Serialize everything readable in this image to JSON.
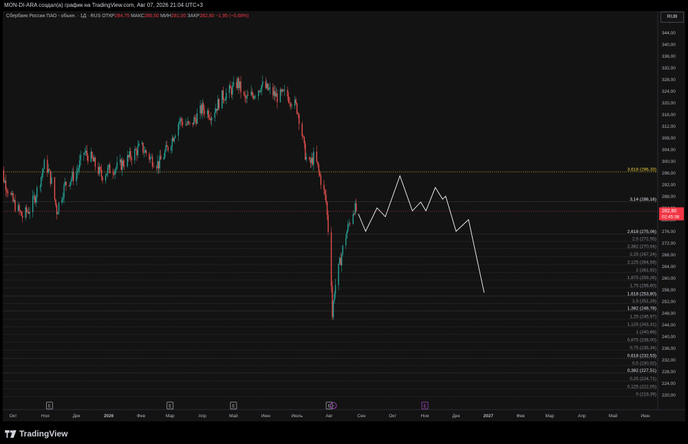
{
  "header": {
    "title": "MON-DI-ARA создал(а) график на TradingView.com, Авг 07, 2026 21:04 UTC+3"
  },
  "legend": {
    "symbol": "Сбербанк России ПАО - обыкн. · 1Д · RUS",
    "open_label": "ОТКР",
    "open": "284,75",
    "high_label": "МАКС",
    "high": "285,50",
    "low_label": "МИН",
    "low": "281,00",
    "close_label": "ЗАКР",
    "close": "282,80",
    "change": "−1,95 (−0,68%)"
  },
  "currency": "RUB",
  "brand": {
    "name": "TradingView"
  },
  "colors": {
    "background": "#131313",
    "up": "#26a69a",
    "down": "#ef5350",
    "price_tag": "#f23645",
    "fib_top": "#f5d142",
    "fib_line": "#5d606b",
    "projection": "#ffffff"
  },
  "chart_data": {
    "type": "candlestick",
    "ylim": [
      218,
      350
    ],
    "y_ticks": [
      "220,00",
      "224,00",
      "228,00",
      "232,00",
      "236,00",
      "240,00",
      "244,00",
      "248,00",
      "252,00",
      "256,00",
      "260,00",
      "264,00",
      "268,00",
      "272,00",
      "276,00",
      "280,00",
      "284,00",
      "288,00",
      "292,00",
      "296,00",
      "300,00",
      "304,00",
      "308,00",
      "312,00",
      "316,00",
      "320,00",
      "324,00",
      "328,00",
      "332,00",
      "336,00",
      "340,00",
      "344,00",
      "348,00"
    ],
    "x_ticks": [
      {
        "label": "Окт",
        "date": "2025-10-01"
      },
      {
        "label": "Ноя",
        "date": "2025-11-01"
      },
      {
        "label": "Дек",
        "date": "2025-12-01"
      },
      {
        "label": "2026",
        "date": "2026-01-01"
      },
      {
        "label": "Фев",
        "date": "2026-02-01"
      },
      {
        "label": "Мар",
        "date": "2026-03-01"
      },
      {
        "label": "Апр",
        "date": "2026-04-01"
      },
      {
        "label": "Май",
        "date": "2026-05-01"
      },
      {
        "label": "Июн",
        "date": "2026-06-01"
      },
      {
        "label": "Июль",
        "date": "2026-07-01"
      },
      {
        "label": "Авг",
        "date": "2026-08-01"
      },
      {
        "label": "Сен",
        "date": "2026-09-01"
      },
      {
        "label": "Окт",
        "date": "2026-10-01"
      },
      {
        "label": "Ноя",
        "date": "2026-11-01"
      },
      {
        "label": "Дек",
        "date": "2026-12-01"
      },
      {
        "label": "2027",
        "date": "2027-01-01"
      },
      {
        "label": "Фев",
        "date": "2027-02-01"
      },
      {
        "label": "Мар",
        "date": "2027-03-01"
      },
      {
        "label": "Апр",
        "date": "2027-04-01"
      },
      {
        "label": "Май",
        "date": "2027-05-01"
      },
      {
        "label": "Июн",
        "date": "2027-06-01"
      }
    ],
    "price_path": [
      [
        "2025-09-15",
        299
      ],
      [
        "2025-09-22",
        294
      ],
      [
        "2025-10-01",
        286
      ],
      [
        "2025-10-10",
        281
      ],
      [
        "2025-10-18",
        284
      ],
      [
        "2025-10-25",
        291
      ],
      [
        "2025-11-01",
        300
      ],
      [
        "2025-11-07",
        293
      ],
      [
        "2025-11-12",
        283
      ],
      [
        "2025-11-20",
        292
      ],
      [
        "2025-12-01",
        296
      ],
      [
        "2025-12-08",
        303
      ],
      [
        "2025-12-15",
        301
      ],
      [
        "2025-12-25",
        295
      ],
      [
        "2026-01-01",
        297
      ],
      [
        "2026-01-10",
        298
      ],
      [
        "2026-01-20",
        301
      ],
      [
        "2026-02-01",
        305
      ],
      [
        "2026-02-10",
        301
      ],
      [
        "2026-02-18",
        299
      ],
      [
        "2026-03-01",
        306
      ],
      [
        "2026-03-10",
        314
      ],
      [
        "2026-03-20",
        312
      ],
      [
        "2026-04-01",
        318
      ],
      [
        "2026-04-10",
        316
      ],
      [
        "2026-04-20",
        322
      ],
      [
        "2026-05-01",
        325
      ],
      [
        "2026-05-05",
        327
      ],
      [
        "2026-05-12",
        321
      ],
      [
        "2026-05-20",
        323
      ],
      [
        "2026-05-28",
        326
      ],
      [
        "2026-06-05",
        324
      ],
      [
        "2026-06-12",
        322
      ],
      [
        "2026-06-20",
        323
      ],
      [
        "2026-06-28",
        320
      ],
      [
        "2026-07-01",
        318
      ],
      [
        "2026-07-05",
        312
      ],
      [
        "2026-07-08",
        304
      ],
      [
        "2026-07-12",
        298
      ],
      [
        "2026-07-18",
        302
      ],
      [
        "2026-07-22",
        296
      ],
      [
        "2026-07-26",
        291
      ],
      [
        "2026-07-29",
        286
      ],
      [
        "2026-08-01",
        272
      ],
      [
        "2026-08-03",
        259
      ],
      [
        "2026-08-04",
        247
      ],
      [
        "2026-08-06",
        256
      ],
      [
        "2026-08-10",
        263
      ],
      [
        "2026-08-14",
        270
      ],
      [
        "2026-08-18",
        276
      ],
      [
        "2026-08-22",
        281
      ],
      [
        "2026-08-25",
        284
      ],
      [
        "2026-08-27",
        283
      ]
    ],
    "last_price": "282,80",
    "countdown": "02:45:38",
    "projection": [
      [
        "2026-08-29",
        282
      ],
      [
        "2026-09-05",
        276
      ],
      [
        "2026-09-16",
        284
      ],
      [
        "2026-09-24",
        281
      ],
      [
        "2026-10-08",
        295
      ],
      [
        "2026-10-20",
        283
      ],
      [
        "2026-10-28",
        286
      ],
      [
        "2026-11-02",
        283
      ],
      [
        "2026-11-11",
        291
      ],
      [
        "2026-11-18",
        287
      ],
      [
        "2026-11-21",
        288
      ],
      [
        "2026-12-01",
        276
      ],
      [
        "2026-12-13",
        280
      ],
      [
        "2026-12-28",
        255
      ]
    ],
    "fib_levels": [
      {
        "label": "3,618 (296,33)",
        "value": 296.33,
        "highlight": "gold"
      },
      {
        "label": "3,14 (286,16)",
        "value": 286.16,
        "highlight": "bold"
      },
      {
        "label": "2,618 (275,06)",
        "value": 275.06,
        "highlight": "bold"
      },
      {
        "label": "2,5 (272,55)",
        "value": 272.55
      },
      {
        "label": "2,382 (270,04)",
        "value": 270.04
      },
      {
        "label": "2,25 (267,24)",
        "value": 267.24
      },
      {
        "label": "2,125 (264,58)",
        "value": 264.58
      },
      {
        "label": "2 (261,92)",
        "value": 261.92
      },
      {
        "label": "1,875 (259,26)",
        "value": 259.26
      },
      {
        "label": "1,75 (256,60)",
        "value": 256.6
      },
      {
        "label": "1,618 (253,80)",
        "value": 253.8,
        "highlight": "bold"
      },
      {
        "label": "1,5 (251,29)",
        "value": 251.29
      },
      {
        "label": "1,382 (248,78)",
        "value": 248.78,
        "highlight": "bold"
      },
      {
        "label": "1,25 (245,97)",
        "value": 245.97
      },
      {
        "label": "1,125 (243,31)",
        "value": 243.31
      },
      {
        "label": "1 (240,66)",
        "value": 240.66
      },
      {
        "label": "0,875 (238,00)",
        "value": 238.0
      },
      {
        "label": "0,75 (235,34)",
        "value": 235.34
      },
      {
        "label": "0,618 (232,53)",
        "value": 232.53,
        "highlight": "bold"
      },
      {
        "label": "0,5 (230,02)",
        "value": 230.02
      },
      {
        "label": "0,382 (227,51)",
        "value": 227.51,
        "highlight": "bold"
      },
      {
        "label": "0,25 (224,71)",
        "value": 224.71
      },
      {
        "label": "0,125 (222,05)",
        "value": 222.05
      },
      {
        "label": "0 (219,39)",
        "value": 219.39
      }
    ],
    "events": [
      {
        "label": "E",
        "date": "2025-11-05",
        "kind": "earnings"
      },
      {
        "label": "E",
        "date": "2026-03-01",
        "kind": "earnings"
      },
      {
        "label": "E",
        "date": "2026-05-01",
        "kind": "earnings"
      },
      {
        "label": "E",
        "date": "2026-08-01",
        "kind": "earnings"
      },
      {
        "label": "⚡",
        "date": "2026-08-05",
        "kind": "split"
      },
      {
        "label": "E",
        "date": "2026-11-01",
        "kind": "future-earnings"
      }
    ]
  }
}
